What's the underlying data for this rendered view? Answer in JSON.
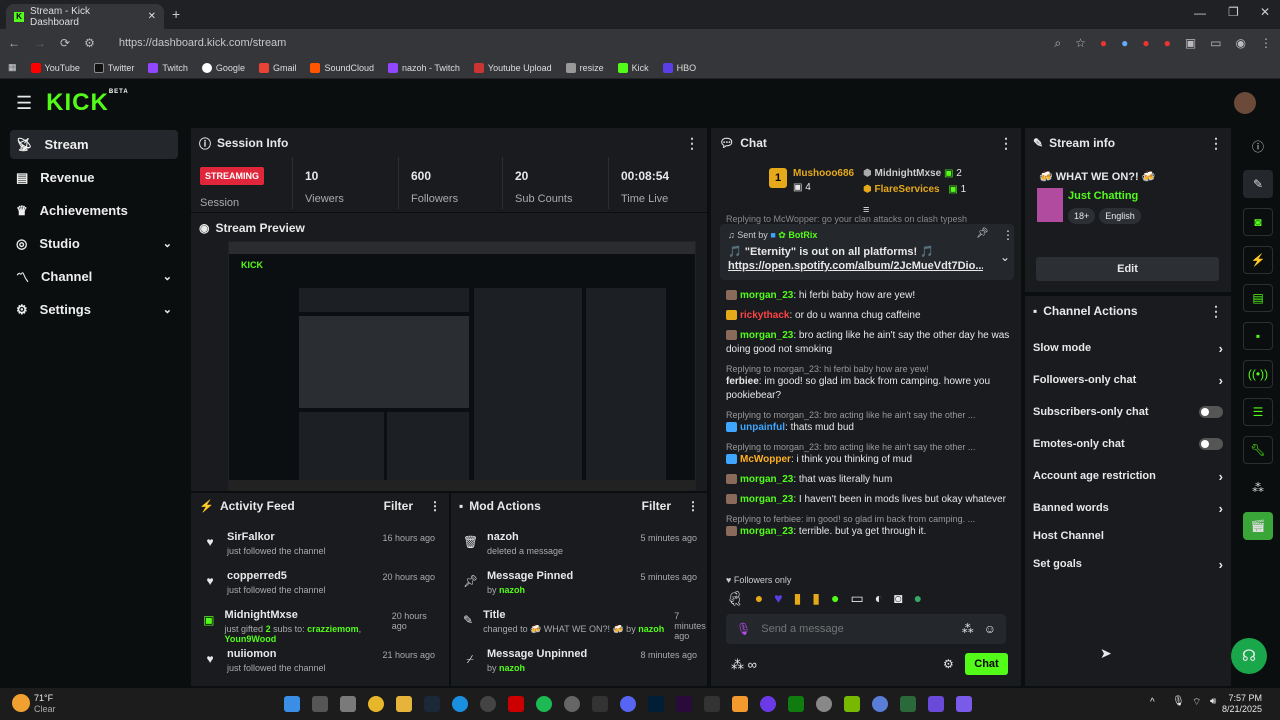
{
  "browser": {
    "tab_title": "Stream - Kick Dashboard",
    "url": "https://dashboard.kick.com/stream",
    "bookmarks": [
      "YouTube",
      "Twitter",
      "Twitch",
      "Google",
      "Gmail",
      "SoundCloud",
      "nazoh - Twitch",
      "Youtube Upload",
      "resize",
      "Kick",
      "HBO"
    ]
  },
  "header": {
    "logo": "KICK",
    "beta": "BETA"
  },
  "sidebar": {
    "items": [
      {
        "label": "Stream",
        "icon": "broadcast-icon",
        "active": true,
        "expand": false
      },
      {
        "label": "Revenue",
        "icon": "chart-icon",
        "active": false,
        "expand": false
      },
      {
        "label": "Achievements",
        "icon": "trophy-icon",
        "active": false,
        "expand": false
      },
      {
        "label": "Studio",
        "icon": "studio-icon",
        "active": false,
        "expand": true
      },
      {
        "label": "Channel",
        "icon": "channel-icon",
        "active": false,
        "expand": true
      },
      {
        "label": "Settings",
        "icon": "gear-icon",
        "active": false,
        "expand": true
      }
    ]
  },
  "session": {
    "title": "Session Info",
    "status": "STREAMING",
    "status_label": "Session",
    "stats": [
      {
        "value": "10",
        "label": "Viewers"
      },
      {
        "value": "600",
        "label": "Followers"
      },
      {
        "value": "20",
        "label": "Sub Counts"
      },
      {
        "value": "00:08:54",
        "label": "Time Live"
      }
    ]
  },
  "preview": {
    "title": "Stream Preview"
  },
  "activity": {
    "title": "Activity Feed",
    "filter": "Filter",
    "items": [
      {
        "name": "SirFalkor",
        "desc": "just followed the channel",
        "time": "16 hours ago",
        "icon": "heart-icon"
      },
      {
        "name": "copperred5",
        "desc": "just followed the channel",
        "time": "20 hours ago",
        "icon": "heart-icon"
      },
      {
        "name": "MidnightMxse",
        "desc_pre": "just gifted ",
        "count": "2",
        "desc_mid": " subs to: ",
        "r1": "crazziemom",
        "sep": ", ",
        "r2": "Youn9Wood",
        "time": "20 hours ago",
        "icon": "gift-icon"
      },
      {
        "name": "nuiiomon",
        "desc": "just followed the channel",
        "time": "21 hours ago",
        "icon": "heart-icon"
      }
    ]
  },
  "mod": {
    "title": "Mod Actions",
    "filter": "Filter",
    "items": [
      {
        "title": "nazoh",
        "desc": "deleted a message",
        "by": "",
        "time": "5 minutes ago",
        "icon": "trash-icon"
      },
      {
        "title": "Message Pinned",
        "desc": "by ",
        "by": "nazoh",
        "time": "5 minutes ago",
        "icon": "pin-icon"
      },
      {
        "title": "Title",
        "desc": "changed to 🍻 WHAT WE ON?! 🍻 by ",
        "by": "nazoh",
        "time": "7 minutes ago",
        "icon": "title-icon"
      },
      {
        "title": "Message Unpinned",
        "desc": "by ",
        "by": "nazoh",
        "time": "8 minutes ago",
        "icon": "unpin-icon"
      }
    ]
  },
  "chat": {
    "title": "Chat",
    "top": [
      {
        "rank": "1",
        "name": "Mushooo686",
        "count": "4"
      },
      {
        "name": "MidnightMxse",
        "count": "2"
      },
      {
        "name": "FlareServices",
        "count": "1"
      }
    ],
    "reply_peek": "Replying to McWopper: go your clan attacks on clash typesh",
    "pinned": {
      "sent_by": "Sent by",
      "sender": "BotRix",
      "text": "🎵 \"Eternity\" is out on all platforms! 🎵",
      "link": "https://open.spotify.com/album/2JcMueVdt7Dio..."
    },
    "messages": [
      {
        "reply": "",
        "user": "morgan_23",
        "color": "#53fc18",
        "text": "hi ferbi baby how are yew!"
      },
      {
        "reply": "",
        "user": "rickythack",
        "color": "#ff4444",
        "text": "or do u wanna chug caffeine"
      },
      {
        "reply": "",
        "user": "morgan_23",
        "color": "#53fc18",
        "text": "bro acting like he ain't say the other day he was doing good not smoking"
      },
      {
        "reply": "Replying to morgan_23: hi ferbi baby how are yew!",
        "user": "ferbiee",
        "color": "#e8e8e8",
        "text": "im good! so glad im back from camping. howre you pookiebear?"
      },
      {
        "reply": "Replying to morgan_23: bro acting like he ain't say the other ...",
        "user": "unpainful",
        "color": "#3ea6ff",
        "text": "thats mud bud"
      },
      {
        "reply": "Replying to morgan_23: bro acting like he ain't say the other ...",
        "user": "McWopper",
        "color": "#ffb020",
        "text": "i think you thinking of mud"
      },
      {
        "reply": "",
        "user": "morgan_23",
        "color": "#53fc18",
        "text": "that was literally hum"
      },
      {
        "reply": "",
        "user": "morgan_23",
        "color": "#53fc18",
        "text": "I haven't been in mods lives but okay whatever"
      },
      {
        "reply": "Replying to ferbiee: im good! so glad im back from camping. ...",
        "user": "morgan_23",
        "color": "#53fc18",
        "text": "terrible. but ya get through it."
      }
    ],
    "followers_only": "Followers only",
    "input_placeholder": "Send a message",
    "send_label": "Chat"
  },
  "stream_info": {
    "title": "Stream info",
    "stream_title": "🍻 WHAT WE ON?! 🍻",
    "category": "Just Chatting",
    "tags": [
      "18+",
      "English"
    ],
    "edit": "Edit"
  },
  "channel_actions": {
    "title": "Channel Actions",
    "items": [
      {
        "label": "Slow mode",
        "type": "arrow"
      },
      {
        "label": "Followers-only chat",
        "type": "arrow"
      },
      {
        "label": "Subscribers-only chat",
        "type": "toggle"
      },
      {
        "label": "Emotes-only chat",
        "type": "toggle"
      },
      {
        "label": "Account age restriction",
        "type": "arrow"
      },
      {
        "label": "Banned words",
        "type": "arrow"
      },
      {
        "label": "Host Channel",
        "type": "none"
      },
      {
        "label": "Set goals",
        "type": "arrow"
      }
    ]
  },
  "taskbar": {
    "weather_temp": "71°F",
    "weather_desc": "Clear",
    "time": "7:57 PM",
    "date": "8/21/2025"
  },
  "colors": {
    "accent": "#53fc18",
    "streaming": "#e0263a",
    "panel": "#191b1f"
  }
}
